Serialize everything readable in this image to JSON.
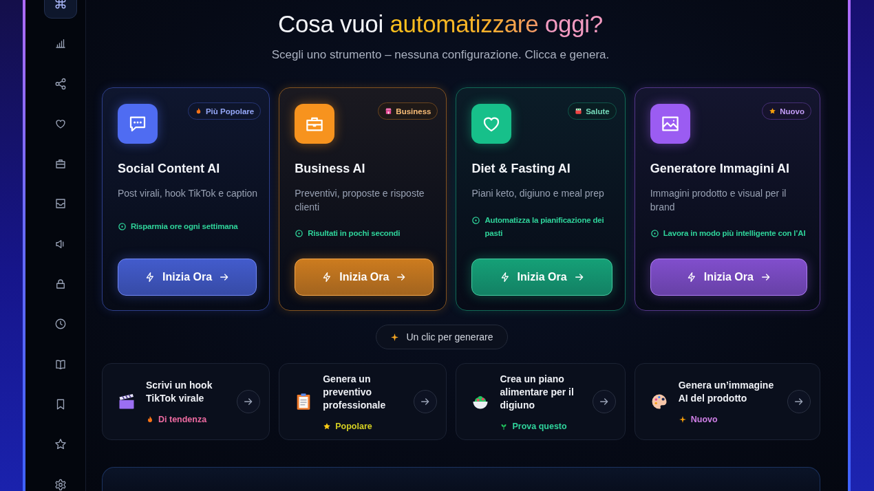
{
  "sidebar": {
    "items": [
      {
        "selected": true
      },
      {
        "selected": false
      },
      {
        "selected": false
      },
      {
        "selected": false
      },
      {
        "selected": false
      },
      {
        "selected": false
      },
      {
        "selected": false
      },
      {
        "selected": false
      },
      {
        "selected": false
      },
      {
        "selected": false
      },
      {
        "selected": false
      },
      {
        "selected": false
      },
      {
        "selected": false
      }
    ]
  },
  "header": {
    "title": [
      {
        "text": "Cosa vuoi",
        "kind": "plain"
      },
      {
        "text": "automatizzare",
        "kind": "gradient"
      },
      {
        "text": "oggi?",
        "kind": "accent"
      }
    ],
    "subtitle": "Scegli uno strumento – nessuna configurazione. Clicca e genera."
  },
  "tools": [
    {
      "name": "Social Content AI",
      "color": "#4f6cf2",
      "badge": "Più Popolare",
      "description": "Post virali, hook TikTok e caption",
      "benefit": "Risparmia ore ogni settimana",
      "button": "Inizia Ora"
    },
    {
      "name": "Business AI",
      "color": "#f7931e",
      "badge": "Business",
      "description": "Preventivi, proposte e risposte clienti",
      "benefit": "Risultati in pochi secondi",
      "button": "Inizia Ora"
    },
    {
      "name": "Diet & Fasting AI",
      "color": "#17c08a",
      "badge": "Salute",
      "description": "Piani keto, digiuno e meal prep",
      "benefit": "Automatizza la pianificazione dei pasti",
      "button": "Inizia Ora"
    },
    {
      "name": "Generatore Immagini AI",
      "color": "#9b5cf2",
      "badge": "Nuovo",
      "description": "Immagini prodotto e visual per il brand",
      "benefit": "Lavora in modo più intelligente con l’AI",
      "button": "Inizia Ora"
    }
  ],
  "hint": "Un clic per generare",
  "quick_actions": [
    {
      "text": "Scrivi un hook TikTok virale",
      "tag": {
        "label": "Di tendenza",
        "color": "#ec6aa0"
      }
    },
    {
      "text": "Genera un preventivo professionale",
      "tag": {
        "label": "Popolare",
        "color": "#d4cf22"
      }
    },
    {
      "text": "Crea un piano alimentare per il digiuno",
      "tag": {
        "label": "Prova questo",
        "color": "#2fd49c"
      }
    },
    {
      "text": "Genera un’immagine AI del prodotto",
      "tag": {
        "label": "Nuovo",
        "color": "#cf7fe6"
      }
    }
  ]
}
